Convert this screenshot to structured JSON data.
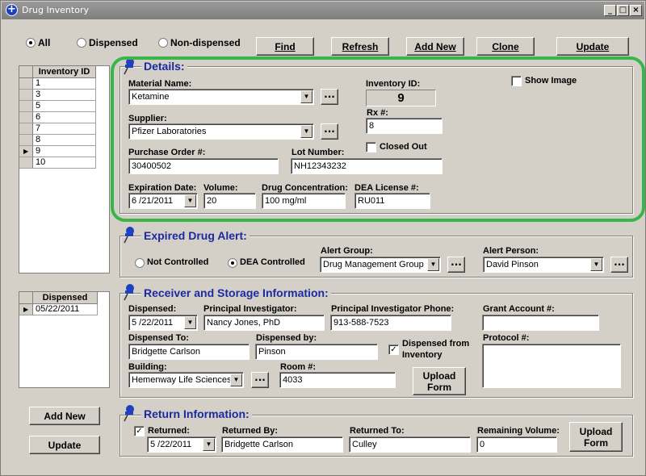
{
  "window": {
    "title": "Drug Inventory"
  },
  "filter": {
    "all": "All",
    "dispensed": "Dispensed",
    "non_dispensed": "Non-dispensed",
    "selected": "All"
  },
  "toolbar": {
    "find": "Find",
    "refresh": "Refresh",
    "add_new": "Add New",
    "clone": "Clone",
    "update": "Update"
  },
  "inventory_list": {
    "header": "Inventory ID",
    "rows": [
      "1",
      "3",
      "5",
      "6",
      "7",
      "8",
      "9",
      "10"
    ],
    "selected": "9"
  },
  "dispensed_list": {
    "header": "Dispensed",
    "rows": [
      "05/22/2011"
    ]
  },
  "left_buttons": {
    "add_new": "Add New",
    "update": "Update"
  },
  "details": {
    "title": "Details:",
    "material_name_label": "Material Name:",
    "material_name": "Ketamine",
    "inventory_id_label": "Inventory ID:",
    "inventory_id": "9",
    "show_image": "Show Image",
    "rx_label": "Rx #:",
    "rx": "8",
    "supplier_label": "Supplier:",
    "supplier": "Pfizer Laboratories",
    "closed_out": "Closed Out",
    "po_label": "Purchase Order #:",
    "po": "30400502",
    "lot_label": "Lot Number:",
    "lot": "NH12343232",
    "exp_label": "Expiration Date:",
    "exp": "6 /21/2011",
    "volume_label": "Volume:",
    "volume": "20",
    "conc_label": "Drug Concentration:",
    "conc": "100 mg/ml",
    "dea_label": "DEA License #:",
    "dea": "RU011"
  },
  "alert": {
    "title": "Expired Drug Alert:",
    "not_controlled": "Not Controlled",
    "dea_controlled": "DEA Controlled",
    "group_label": "Alert Group:",
    "group": "Drug Management Group",
    "person_label": "Alert Person:",
    "person": "David Pinson"
  },
  "receiver": {
    "title": "Receiver and Storage Information:",
    "dispensed_label": "Dispensed:",
    "dispensed": "5 /22/2011",
    "pi_label": "Principal Investigator:",
    "pi": "Nancy Jones, PhD",
    "pi_phone_label": "Principal Investigator Phone:",
    "pi_phone": "913-588-7523",
    "grant_label": "Grant Account #:",
    "grant": "",
    "dispensed_to_label": "Dispensed To:",
    "dispensed_to": "Bridgette Carlson",
    "dispensed_by_label": "Dispensed by:",
    "dispensed_by": "Pinson",
    "from_inventory_1": "Dispensed from",
    "from_inventory_2": "Inventory",
    "protocol_label": "Protocol #:",
    "protocol": "",
    "building_label": "Building:",
    "building": "Hemenway Life Sciences",
    "room_label": "Room #:",
    "room": "4033",
    "upload_1": "Upload",
    "upload_2": "Form"
  },
  "return": {
    "title": "Return Information:",
    "returned_label": "Returned:",
    "returned": "5 /22/2011",
    "returned_by_label": "Returned By:",
    "returned_by": "Bridgette Carlson",
    "returned_to_label": "Returned To:",
    "returned_to": "Culley",
    "remaining_label": "Remaining Volume:",
    "remaining": "0",
    "upload_1": "Upload",
    "upload_2": "Form"
  }
}
